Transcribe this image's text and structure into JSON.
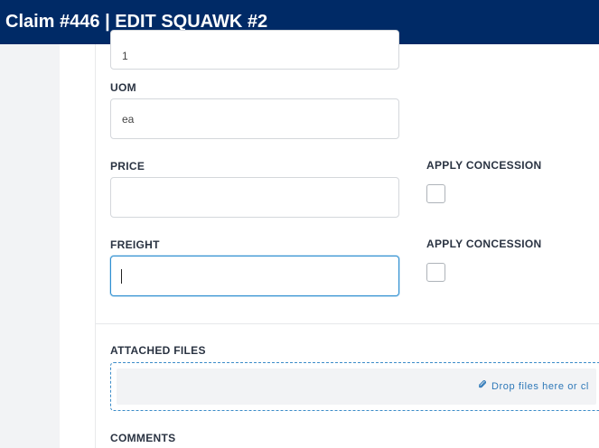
{
  "header": {
    "title": "Claim #446 | EDIT SQUAWK #2"
  },
  "form": {
    "qty": {
      "value": "1"
    },
    "uom": {
      "label": "UOM",
      "value": "ea"
    },
    "price": {
      "label": "PRICE",
      "value": ""
    },
    "price_concession": {
      "label": "APPLY CONCESSION",
      "checked": false
    },
    "freight": {
      "label": "FREIGHT",
      "value": ""
    },
    "freight_concession": {
      "label": "APPLY CONCESSION",
      "checked": false
    }
  },
  "attachments": {
    "label": "ATTACHED FILES",
    "drop_text": "Drop files here or cl",
    "icon": "paperclip-icon"
  },
  "comments": {
    "label": "COMMENTS"
  },
  "colors": {
    "header_bg": "#002a66",
    "accent": "#2e8fd1"
  }
}
